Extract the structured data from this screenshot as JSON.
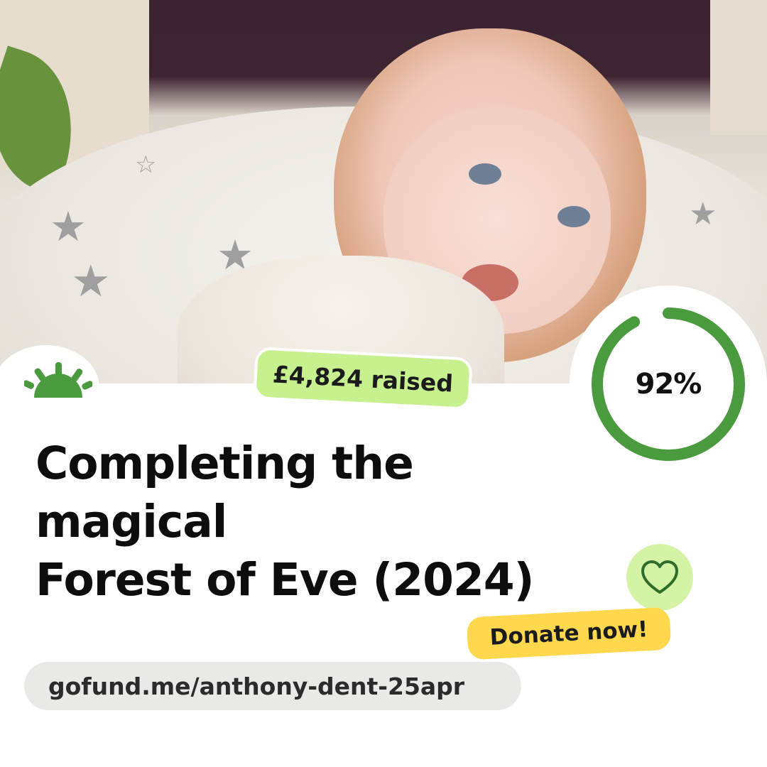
{
  "card": {
    "raised_label": "£4,824 raised",
    "progress_percent_label": "92%",
    "progress_fraction": 0.92,
    "title_line1": "Completing the magical",
    "title_line2": "Forest of Eve (2024)",
    "donate_label": "Donate now!",
    "url": "gofund.me/anthony-dent-25apr"
  },
  "icons": {
    "logo": "gofundme-sunrise-logo",
    "heart": "heart-icon"
  },
  "colors": {
    "brand_green": "#4a9a3e",
    "raised_bg": "#c7f08e",
    "donate_bg": "#ffd84d",
    "heart_bg": "#d4f3a5",
    "url_bg": "#e9e9e7",
    "progress_track": "#ffffff",
    "text": "#0d0d0d"
  }
}
